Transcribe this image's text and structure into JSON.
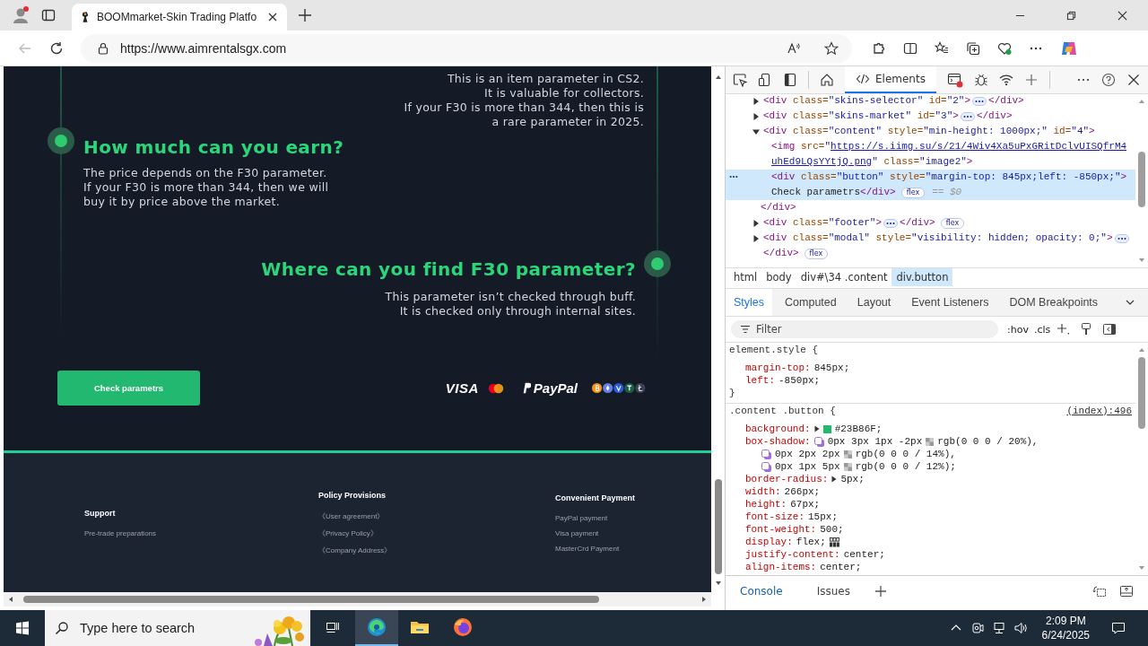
{
  "browser": {
    "tabs": [
      {
        "title": "BOOMmarket-Skin Trading Platfo",
        "selected": true
      }
    ],
    "address": "https://www.aimrentalsgx.com",
    "back_disabled": true
  },
  "page": {
    "intro_lines": [
      "This is an item parameter in CS2.",
      "It is valuable for collectors.",
      "If your F30 is more than 344, then this is",
      "a rare parameter in 2025."
    ],
    "sections": [
      {
        "kind": "left",
        "heading": "How much can you earn?",
        "lines": [
          "The price depends on the F30 parameter.",
          "If your F30 is more than 344, then we will",
          "buy it by price above the market."
        ]
      },
      {
        "kind": "right",
        "heading": "Where can you find F30 parameter?",
        "lines": [
          "This parameter isn’t checked through buff.",
          "It is checked only through internal sites."
        ]
      }
    ],
    "button": "Check parametrs",
    "payments": [
      {
        "kind": "visa",
        "text": "VISA"
      },
      {
        "kind": "mastercard"
      },
      {
        "kind": "paypal",
        "text": "PayPal"
      },
      {
        "kind": "crypto"
      }
    ],
    "footer": [
      {
        "heading": "Support",
        "items": [
          "Pre-trade preparations"
        ]
      },
      {
        "heading": "Policy Provisions",
        "items": [
          "《User agreement》",
          "《Privacy Policy》",
          "《Company Address》"
        ]
      },
      {
        "heading": "Convenient Payment",
        "items": [
          "PayPal payment",
          "Visa payment",
          "MasterCrd Payment"
        ]
      }
    ]
  },
  "devtools": {
    "tabs": [
      {
        "label": "Elements",
        "selected": true
      }
    ],
    "dom": [
      {
        "selected": false,
        "expanded": false,
        "lines": [
          [
            {
              "kind": "code",
              "tokens": [
                {
                  "kind": "tag",
                  "text": "<div"
                },
                {
                  "kind": "attr",
                  "text": " class="
                },
                {
                  "kind": "val",
                  "text": "\"skins-selector\""
                },
                {
                  "kind": "attr",
                  "text": " id="
                },
                {
                  "kind": "val",
                  "text": "\"2\""
                },
                {
                  "kind": "tag",
                  "text": ">"
                }
              ]
            },
            {
              "kind": "ellipsis"
            },
            {
              "kind": "code",
              "tokens": [
                {
                  "kind": "tag",
                  "text": "</div>"
                }
              ]
            }
          ]
        ]
      },
      {
        "selected": false,
        "expanded": false,
        "lines": [
          [
            {
              "kind": "code",
              "tokens": [
                {
                  "kind": "tag",
                  "text": "<div"
                },
                {
                  "kind": "attr",
                  "text": " class="
                },
                {
                  "kind": "val",
                  "text": "\"skins-market\""
                },
                {
                  "kind": "attr",
                  "text": " id="
                },
                {
                  "kind": "val",
                  "text": "\"3\""
                },
                {
                  "kind": "tag",
                  "text": ">"
                }
              ]
            },
            {
              "kind": "ellipsis"
            },
            {
              "kind": "code",
              "tokens": [
                {
                  "kind": "tag",
                  "text": "</div>"
                }
              ]
            }
          ]
        ]
      },
      {
        "selected": false,
        "expanded": true,
        "lines": [
          [
            {
              "kind": "code",
              "tokens": [
                {
                  "kind": "tag",
                  "text": "<div"
                },
                {
                  "kind": "attr",
                  "text": " class="
                },
                {
                  "kind": "val",
                  "text": "\"content\""
                },
                {
                  "kind": "attr",
                  "text": " style="
                },
                {
                  "kind": "val",
                  "text": "\"min-height: 1000px;\""
                },
                {
                  "kind": "attr",
                  "text": " id="
                },
                {
                  "kind": "val",
                  "text": "\"4\""
                },
                {
                  "kind": "tag",
                  "text": ">"
                }
              ]
            }
          ]
        ],
        "children": [
          {
            "selected": false,
            "lines": [
              [
                {
                  "kind": "code",
                  "tokens": [
                    {
                      "kind": "tag",
                      "text": "<img"
                    },
                    {
                      "kind": "attr",
                      "text": " src="
                    },
                    {
                      "kind": "val",
                      "text": "\""
                    },
                    {
                      "kind": "link",
                      "text": "https://s.iimg.su/s/21/4Wiv4Xa5uPxGRitDclvUISQfrM4"
                    }
                  ]
                }
              ],
              [
                {
                  "kind": "code",
                  "tokens": [
                    {
                      "kind": "link",
                      "text": "uhEd9LQsYYtjQ.png"
                    },
                    {
                      "kind": "val",
                      "text": "\""
                    },
                    {
                      "kind": "attr",
                      "text": " class="
                    },
                    {
                      "kind": "val",
                      "text": "\"image2\""
                    },
                    {
                      "kind": "tag",
                      "text": ">"
                    }
                  ]
                }
              ]
            ]
          },
          {
            "selected": true,
            "lines": [
              [
                {
                  "kind": "code",
                  "tokens": [
                    {
                      "kind": "tag",
                      "text": "<div"
                    },
                    {
                      "kind": "attr",
                      "text": " class="
                    },
                    {
                      "kind": "val",
                      "text": "\"button\""
                    },
                    {
                      "kind": "attr",
                      "text": " style="
                    },
                    {
                      "kind": "val",
                      "text": "\"margin-top: 845px;left: -850px;\""
                    },
                    {
                      "kind": "tag",
                      "text": ">"
                    }
                  ]
                }
              ],
              [
                {
                  "kind": "code",
                  "tokens": [
                    {
                      "kind": "text",
                      "text": "Check parametrs"
                    },
                    {
                      "kind": "tag",
                      "text": "</div>"
                    }
                  ]
                },
                {
                  "kind": "badge",
                  "text": "flex"
                },
                {
                  "kind": "code",
                  "tokens": [
                    {
                      "kind": "hint",
                      "text": "== $0"
                    }
                  ]
                }
              ]
            ]
          }
        ],
        "closing": [
          {
            "kind": "code",
            "tokens": [
              {
                "kind": "tag",
                "text": "</div>"
              }
            ]
          }
        ]
      },
      {
        "selected": false,
        "expanded": false,
        "lines": [
          [
            {
              "kind": "code",
              "tokens": [
                {
                  "kind": "tag",
                  "text": "<div"
                },
                {
                  "kind": "attr",
                  "text": " class="
                },
                {
                  "kind": "val",
                  "text": "\"footer\""
                },
                {
                  "kind": "tag",
                  "text": ">"
                }
              ]
            },
            {
              "kind": "ellipsis"
            },
            {
              "kind": "code",
              "tokens": [
                {
                  "kind": "tag",
                  "text": "</div>"
                }
              ]
            },
            {
              "kind": "badge",
              "text": "flex"
            }
          ]
        ]
      },
      {
        "selected": false,
        "expanded": false,
        "lines": [
          [
            {
              "kind": "code",
              "tokens": [
                {
                  "kind": "tag",
                  "text": "<div"
                },
                {
                  "kind": "attr",
                  "text": " class="
                },
                {
                  "kind": "val",
                  "text": "\"modal\""
                },
                {
                  "kind": "attr",
                  "text": " style="
                },
                {
                  "kind": "val",
                  "text": "\"visibility: hidden; opacity: 0;\""
                },
                {
                  "kind": "tag",
                  "text": ">"
                }
              ]
            },
            {
              "kind": "ellipsis"
            }
          ],
          [
            {
              "kind": "code",
              "tokens": [
                {
                  "kind": "tag",
                  "text": "</div>"
                }
              ]
            },
            {
              "kind": "badge",
              "text": "flex"
            }
          ]
        ]
      }
    ],
    "breadcrumbs": [
      {
        "label": "html",
        "selected": false
      },
      {
        "label": "body",
        "selected": false
      },
      {
        "label": "div#\\34 .content",
        "selected": false
      },
      {
        "label": "div.button",
        "selected": true
      }
    ],
    "panel_tabs": [
      {
        "label": "Styles",
        "selected": true
      },
      {
        "label": "Computed",
        "selected": false
      },
      {
        "label": "Layout",
        "selected": false
      },
      {
        "label": "Event Listeners",
        "selected": false
      },
      {
        "label": "DOM Breakpoints",
        "selected": false
      }
    ],
    "filter": {
      "placeholder": "Filter"
    },
    "filter_buttons": [
      ":hov",
      ".cls"
    ],
    "rules": [
      {
        "selector": "element.style {",
        "close": "}",
        "decls": [
          {
            "kind": "plain",
            "prop": "margin-top:",
            "value": "845px;"
          },
          {
            "kind": "plain",
            "prop": "left:",
            "value": "-850px;"
          }
        ]
      },
      {
        "selector": ".content .button {",
        "source": "(index):496",
        "decls": [
          {
            "kind": "color",
            "prop": "background:",
            "value": "#23B86F;",
            "color": "#23b86f"
          },
          {
            "kind": "shadow",
            "prop": "box-shadow:",
            "layers": [
              {
                "offsets": "0px 3px 1px -2px",
                "value": "rgb(0 0 0 / 20%),"
              },
              {
                "offsets": "0px 2px 2px",
                "value": "rgb(0 0 0 / 14%),"
              },
              {
                "offsets": "0px 1px 5px",
                "value": "rgb(0 0 0 / 12%);"
              }
            ]
          },
          {
            "kind": "expand",
            "prop": "border-radius:",
            "value": "5px;"
          },
          {
            "kind": "plain",
            "prop": "width:",
            "value": "266px;"
          },
          {
            "kind": "plain",
            "prop": "height:",
            "value": "67px;"
          },
          {
            "kind": "plain",
            "prop": "font-size:",
            "value": "15px;"
          },
          {
            "kind": "plain",
            "prop": "font-weight:",
            "value": "500;"
          },
          {
            "kind": "flex",
            "prop": "display:",
            "value": "flex;"
          },
          {
            "kind": "plain",
            "prop": "justify-content:",
            "value": "center;"
          },
          {
            "kind": "plain",
            "prop": "align-items:",
            "value": "center;"
          }
        ]
      }
    ],
    "drawer_tabs": [
      {
        "label": "Console",
        "selected": true
      },
      {
        "label": "Issues",
        "selected": false
      }
    ]
  },
  "taskbar": {
    "search_placeholder": "Type here to search",
    "time": "2:09 PM",
    "date": "6/24/2025"
  }
}
